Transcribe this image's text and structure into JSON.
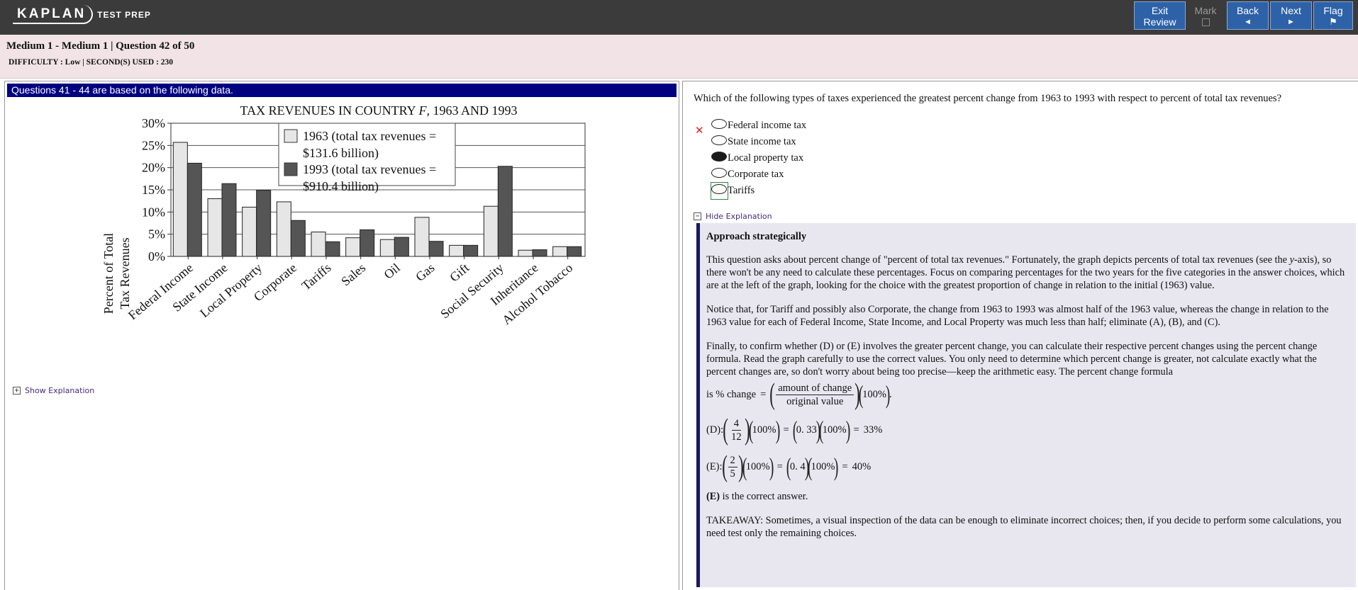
{
  "app": {
    "logo_brand": "KAPLAN",
    "logo_sub": "TEST PREP"
  },
  "toolbar": {
    "exit_review_line1": "Exit",
    "exit_review_line2": "Review",
    "mark_label": "Mark",
    "back_label": "Back",
    "back_glyph": "◄",
    "next_label": "Next",
    "next_glyph": "►",
    "flag_label": "Flag",
    "flag_glyph": "⚑"
  },
  "info": {
    "title": "Medium 1 - Medium 1 | Question  42 of 50",
    "stats": "DIFFICULTY : Low | SECOND(S) USED : 230"
  },
  "stimulus": {
    "header": "Questions 41 - 44 are based on the following data.",
    "show_explanation": "Show Explanation"
  },
  "chart_data": {
    "type": "bar",
    "title_pre": "TAX REVENUES IN COUNTRY ",
    "title_italic": "F",
    "title_post": ", 1963 AND 1993",
    "ylabel_line1": "Percent of Total",
    "ylabel_line2": "Tax Revenues",
    "ylim": [
      0,
      30
    ],
    "yticks": [
      "0%",
      "5%",
      "10%",
      "15%",
      "20%",
      "25%",
      "30%"
    ],
    "grid": true,
    "legend_placement": "top-center",
    "categories": [
      "Federal Income",
      "State Income",
      "Local Property",
      "Corporate",
      "Tariffs",
      "Sales",
      "Oil",
      "Gas",
      "Gift",
      "Social Security",
      "Inheritance",
      "Alcohol Tobacco"
    ],
    "series": [
      {
        "name": "1963",
        "legend_line1": "1963 (total tax revenues =",
        "legend_line2": "$131.6 billion)",
        "color": "#e6e6e6",
        "values": [
          25.7,
          13.0,
          11.1,
          12.3,
          5.5,
          4.2,
          3.8,
          8.8,
          2.5,
          11.3,
          1.4,
          2.2
        ]
      },
      {
        "name": "1993",
        "legend_line1": "1993 (total tax revenues =",
        "legend_line2": "$910.4 billion)",
        "color": "#555555",
        "values": [
          21.0,
          16.4,
          14.9,
          8.1,
          3.3,
          6.0,
          4.3,
          3.4,
          2.5,
          20.3,
          1.5,
          2.2
        ]
      }
    ]
  },
  "question": {
    "stem": "Which of the following types of taxes experienced the greatest percent change from 1963 to 1993 with respect to percent of total tax revenues?",
    "choices": [
      {
        "label": "Federal income tax",
        "selected": false
      },
      {
        "label": "State income tax",
        "selected": false
      },
      {
        "label": "Local property tax",
        "selected": true
      },
      {
        "label": "Corporate tax",
        "selected": false
      },
      {
        "label": "Tariffs",
        "selected": false
      }
    ],
    "wrong_mark": "✕",
    "hide_explanation": "Hide Explanation"
  },
  "explanation": {
    "heading": "Approach strategically",
    "p1_a": "This question asks about percent change of \"percent of total tax revenues.\" Fortunately, the graph depicts percents of total tax revenues (see the ",
    "p1_italic": "y",
    "p1_b": "-axis), so there won't be any need to calculate these percentages. Focus on comparing percentages for the two years for the five categories in the answer choices, which are at the left of the graph, looking for the choice with the greatest proportion of change in relation to the initial (1963) value.",
    "p2": "Notice that, for Tariff and possibly also Corporate, the change from 1963 to 1993 was almost half of the 1963 value, whereas the change in relation to the 1963 value for each of Federal Income, State Income, and Local Property was much less than half; eliminate (A), (B), and (C).",
    "p3": "Finally, to confirm whether (D) or (E) involves the greater percent change, you can calculate their respective percent changes using the percent change formula. Read the graph carefully to use the correct values. You only need to determine which percent change is greater, not calculate exactly what the percent changes are, so don't worry about being too precise—keep the arithmetic easy. The percent change formula",
    "formula_prefix": "is % change",
    "formula_num": "amount  of  change",
    "formula_den": "original  value",
    "formula_pct": "100%",
    "d_label": "(D):",
    "d_num": "4",
    "d_den": "12",
    "d_pct": "100%",
    "d_dec": "0. 33",
    "d_result": "33%",
    "e_label": "(E):",
    "e_num": "2",
    "e_den": "5",
    "e_pct": "100%",
    "e_dec": "0. 4",
    "e_result": "40%",
    "answer_bold": "(E)",
    "answer_rest": " is the correct answer.",
    "takeaway": "TAKEAWAY: Sometimes, a visual inspection of the data can be enough to eliminate incorrect choices; then, if you decide to perform some calculations, you need test only the remaining choices."
  }
}
